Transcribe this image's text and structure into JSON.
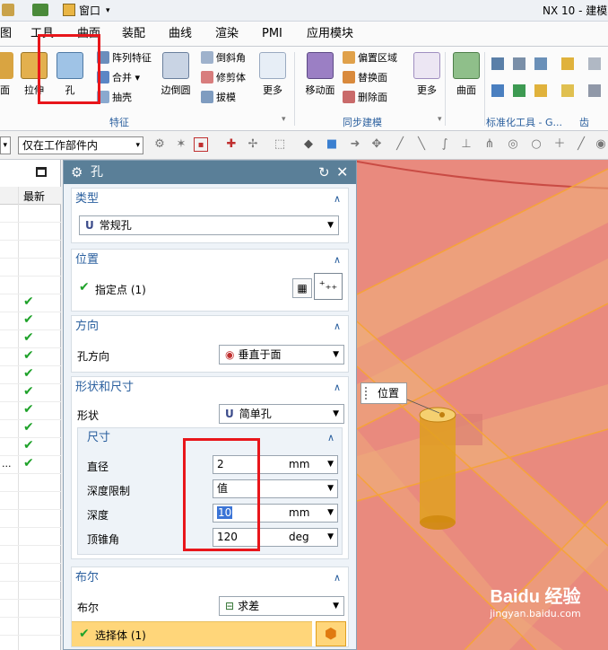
{
  "titlebar": {
    "window_menu": "窗口",
    "app_title": "NX 10 - 建模"
  },
  "menubar": {
    "items": [
      "图",
      "工具",
      "曲面",
      "装配",
      "曲线",
      "渲染",
      "PMI",
      "应用模块"
    ]
  },
  "ribbon": {
    "buttons": {
      "plane": "平面",
      "extrude": "拉伸",
      "hole": "孔",
      "edge_blend": "边倒圆",
      "more1": "更多",
      "move_face": "移动面",
      "more2": "更多",
      "surface": "曲面"
    },
    "feature_small": [
      "阵列特征",
      "合并",
      "抽壳"
    ],
    "feature_small2": [
      "倒斜角",
      "修剪体",
      "拔模"
    ],
    "sync_small": [
      "偏置区域",
      "替换面",
      "删除面"
    ],
    "groups": {
      "feature": "特征",
      "sync": "同步建模",
      "std_tools": "标准化工具 - G...",
      "gear": "齿轮..."
    }
  },
  "toolbar2": {
    "scope_filter": "仅在工作部件内"
  },
  "navigator": {
    "col_latest": "最新",
    "truncated_item": "..."
  },
  "dialog": {
    "title": "孔",
    "type": {
      "header": "类型",
      "value": "常规孔"
    },
    "position": {
      "header": "位置",
      "specify_point": "指定点 (1)"
    },
    "direction": {
      "header": "方向",
      "label": "孔方向",
      "value": "垂直于面"
    },
    "shape": {
      "header": "形状和尺寸",
      "shape_label": "形状",
      "shape_value": "简单孔",
      "dims": {
        "header": "尺寸",
        "diameter_label": "直径",
        "diameter_value": "2",
        "diameter_unit": "mm",
        "depth_limit_label": "深度限制",
        "depth_limit_value": "值",
        "depth_label": "深度",
        "depth_value": "10",
        "depth_unit": "mm",
        "tip_angle_label": "顶锥角",
        "tip_angle_value": "120",
        "tip_angle_unit": "deg"
      }
    },
    "boolean": {
      "header": "布尔",
      "label": "布尔",
      "value": "求差",
      "select_body": "选择体 (1)"
    }
  },
  "viewport": {
    "position_tag": "位置"
  },
  "watermark": {
    "logo": "Baidu 经验",
    "url": "jingyan.baidu.com"
  },
  "colors": {
    "accent": "#2a5f9e",
    "dialog_title": "#5a7f98",
    "highlight": "#e8161b",
    "select_bar": "#ffd67a",
    "check": "#1fa22a"
  }
}
